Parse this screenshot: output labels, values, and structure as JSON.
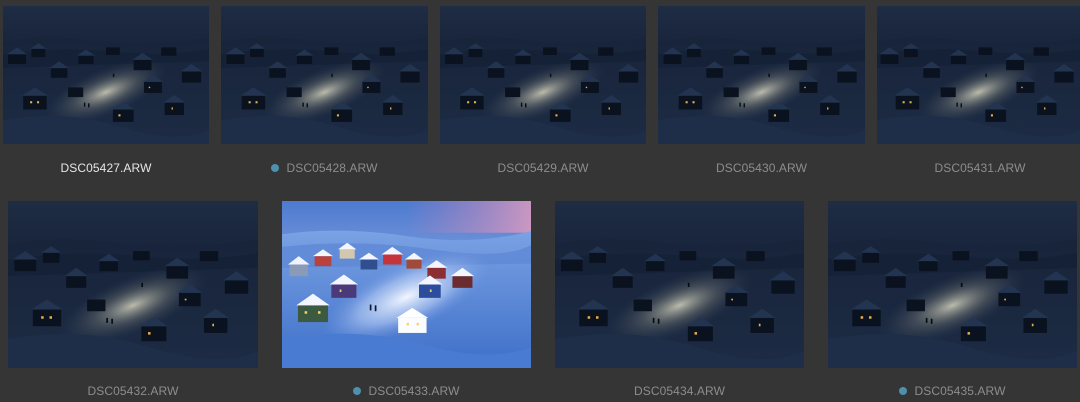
{
  "filmstrip": {
    "items": [
      {
        "filename": "DSC05427.ARW",
        "selected": true,
        "marked": false,
        "edited": false
      },
      {
        "filename": "DSC05428.ARW",
        "selected": false,
        "marked": true,
        "edited": false
      },
      {
        "filename": "DSC05429.ARW",
        "selected": false,
        "marked": false,
        "edited": false
      },
      {
        "filename": "DSC05430.ARW",
        "selected": false,
        "marked": false,
        "edited": false
      },
      {
        "filename": "DSC05431.ARW",
        "selected": false,
        "marked": false,
        "edited": false
      },
      {
        "filename": "DSC05432.ARW",
        "selected": false,
        "marked": false,
        "edited": false
      },
      {
        "filename": "DSC05433.ARW",
        "selected": false,
        "marked": true,
        "edited": true
      },
      {
        "filename": "DSC05434.ARW",
        "selected": false,
        "marked": false,
        "edited": false
      },
      {
        "filename": "DSC05435.ARW",
        "selected": false,
        "marked": true,
        "edited": false
      }
    ],
    "colors": {
      "background": "#353535",
      "label_text": "#8d8d8d",
      "selected_label_text": "#e6e6e6",
      "marker_dot": "#4f8fb0"
    }
  }
}
